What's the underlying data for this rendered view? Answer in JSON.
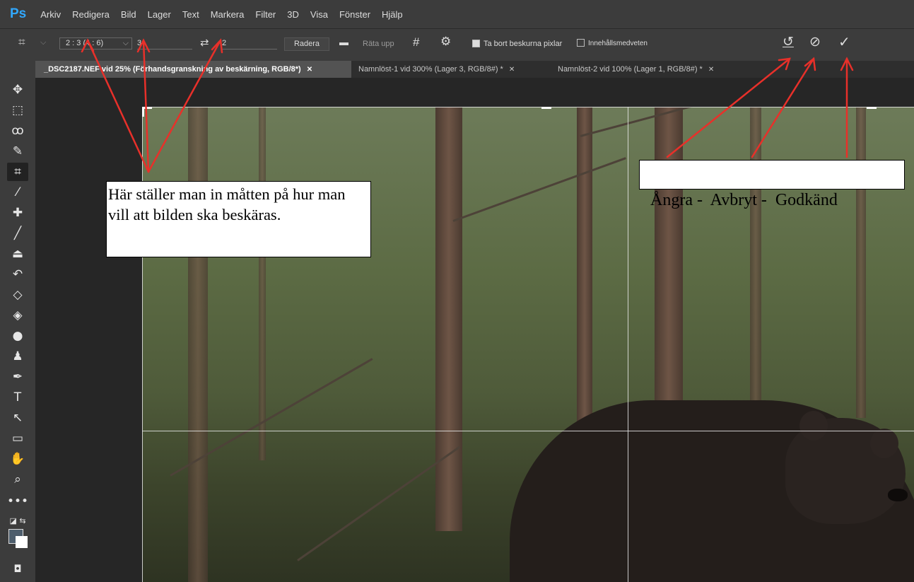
{
  "app": {
    "logo": "Ps"
  },
  "menu": [
    "Arkiv",
    "Redigera",
    "Bild",
    "Lager",
    "Text",
    "Markera",
    "Filter",
    "3D",
    "Visa",
    "Fönster",
    "Hjälp"
  ],
  "options": {
    "ratio_dropdown": "2 : 3 (4 : 6)",
    "width_value": "3",
    "height_value": "2",
    "clear_button": "Radera",
    "straighten_label": "Räta upp",
    "delete_cropped_label": "Ta bort beskurna pixlar",
    "delete_cropped_checked": true,
    "content_aware_label": "Innehållsmedveten",
    "content_aware_checked": false
  },
  "tabs": [
    {
      "label": "_DSC2187.NEF vid 25% (Förhandsgranskning av beskärning, RGB/8*)",
      "active": true
    },
    {
      "label": "Namnlöst-1 vid 300% (Lager 3, RGB/8#) *",
      "active": false
    },
    {
      "label": "Namnlöst-2 vid 100% (Lager 1, RGB/8#) *",
      "active": false
    }
  ],
  "tools": [
    "move-icon",
    "marquee-icon",
    "lasso-icon",
    "quick-select-icon",
    "crop-icon",
    "eyedropper-icon",
    "healing-icon",
    "brush-icon",
    "stamp-icon",
    "history-brush-icon",
    "eraser-icon",
    "bucket-icon",
    "blur-icon",
    "dodge-icon",
    "pen-icon",
    "type-icon",
    "path-select-icon",
    "rectangle-icon",
    "hand-icon",
    "zoom-icon",
    "more-icon"
  ],
  "annotations": {
    "left": "Här ställer man in måtten på hur man vill att bilden ska beskäras.",
    "right": "Ångra -  Avbryt -  Godkänd"
  },
  "colors": {
    "accent": "#31a8ff",
    "arrow": "#e8302a",
    "foreground_swatch": "#4d5d6c",
    "background_swatch": "#ffffff"
  }
}
